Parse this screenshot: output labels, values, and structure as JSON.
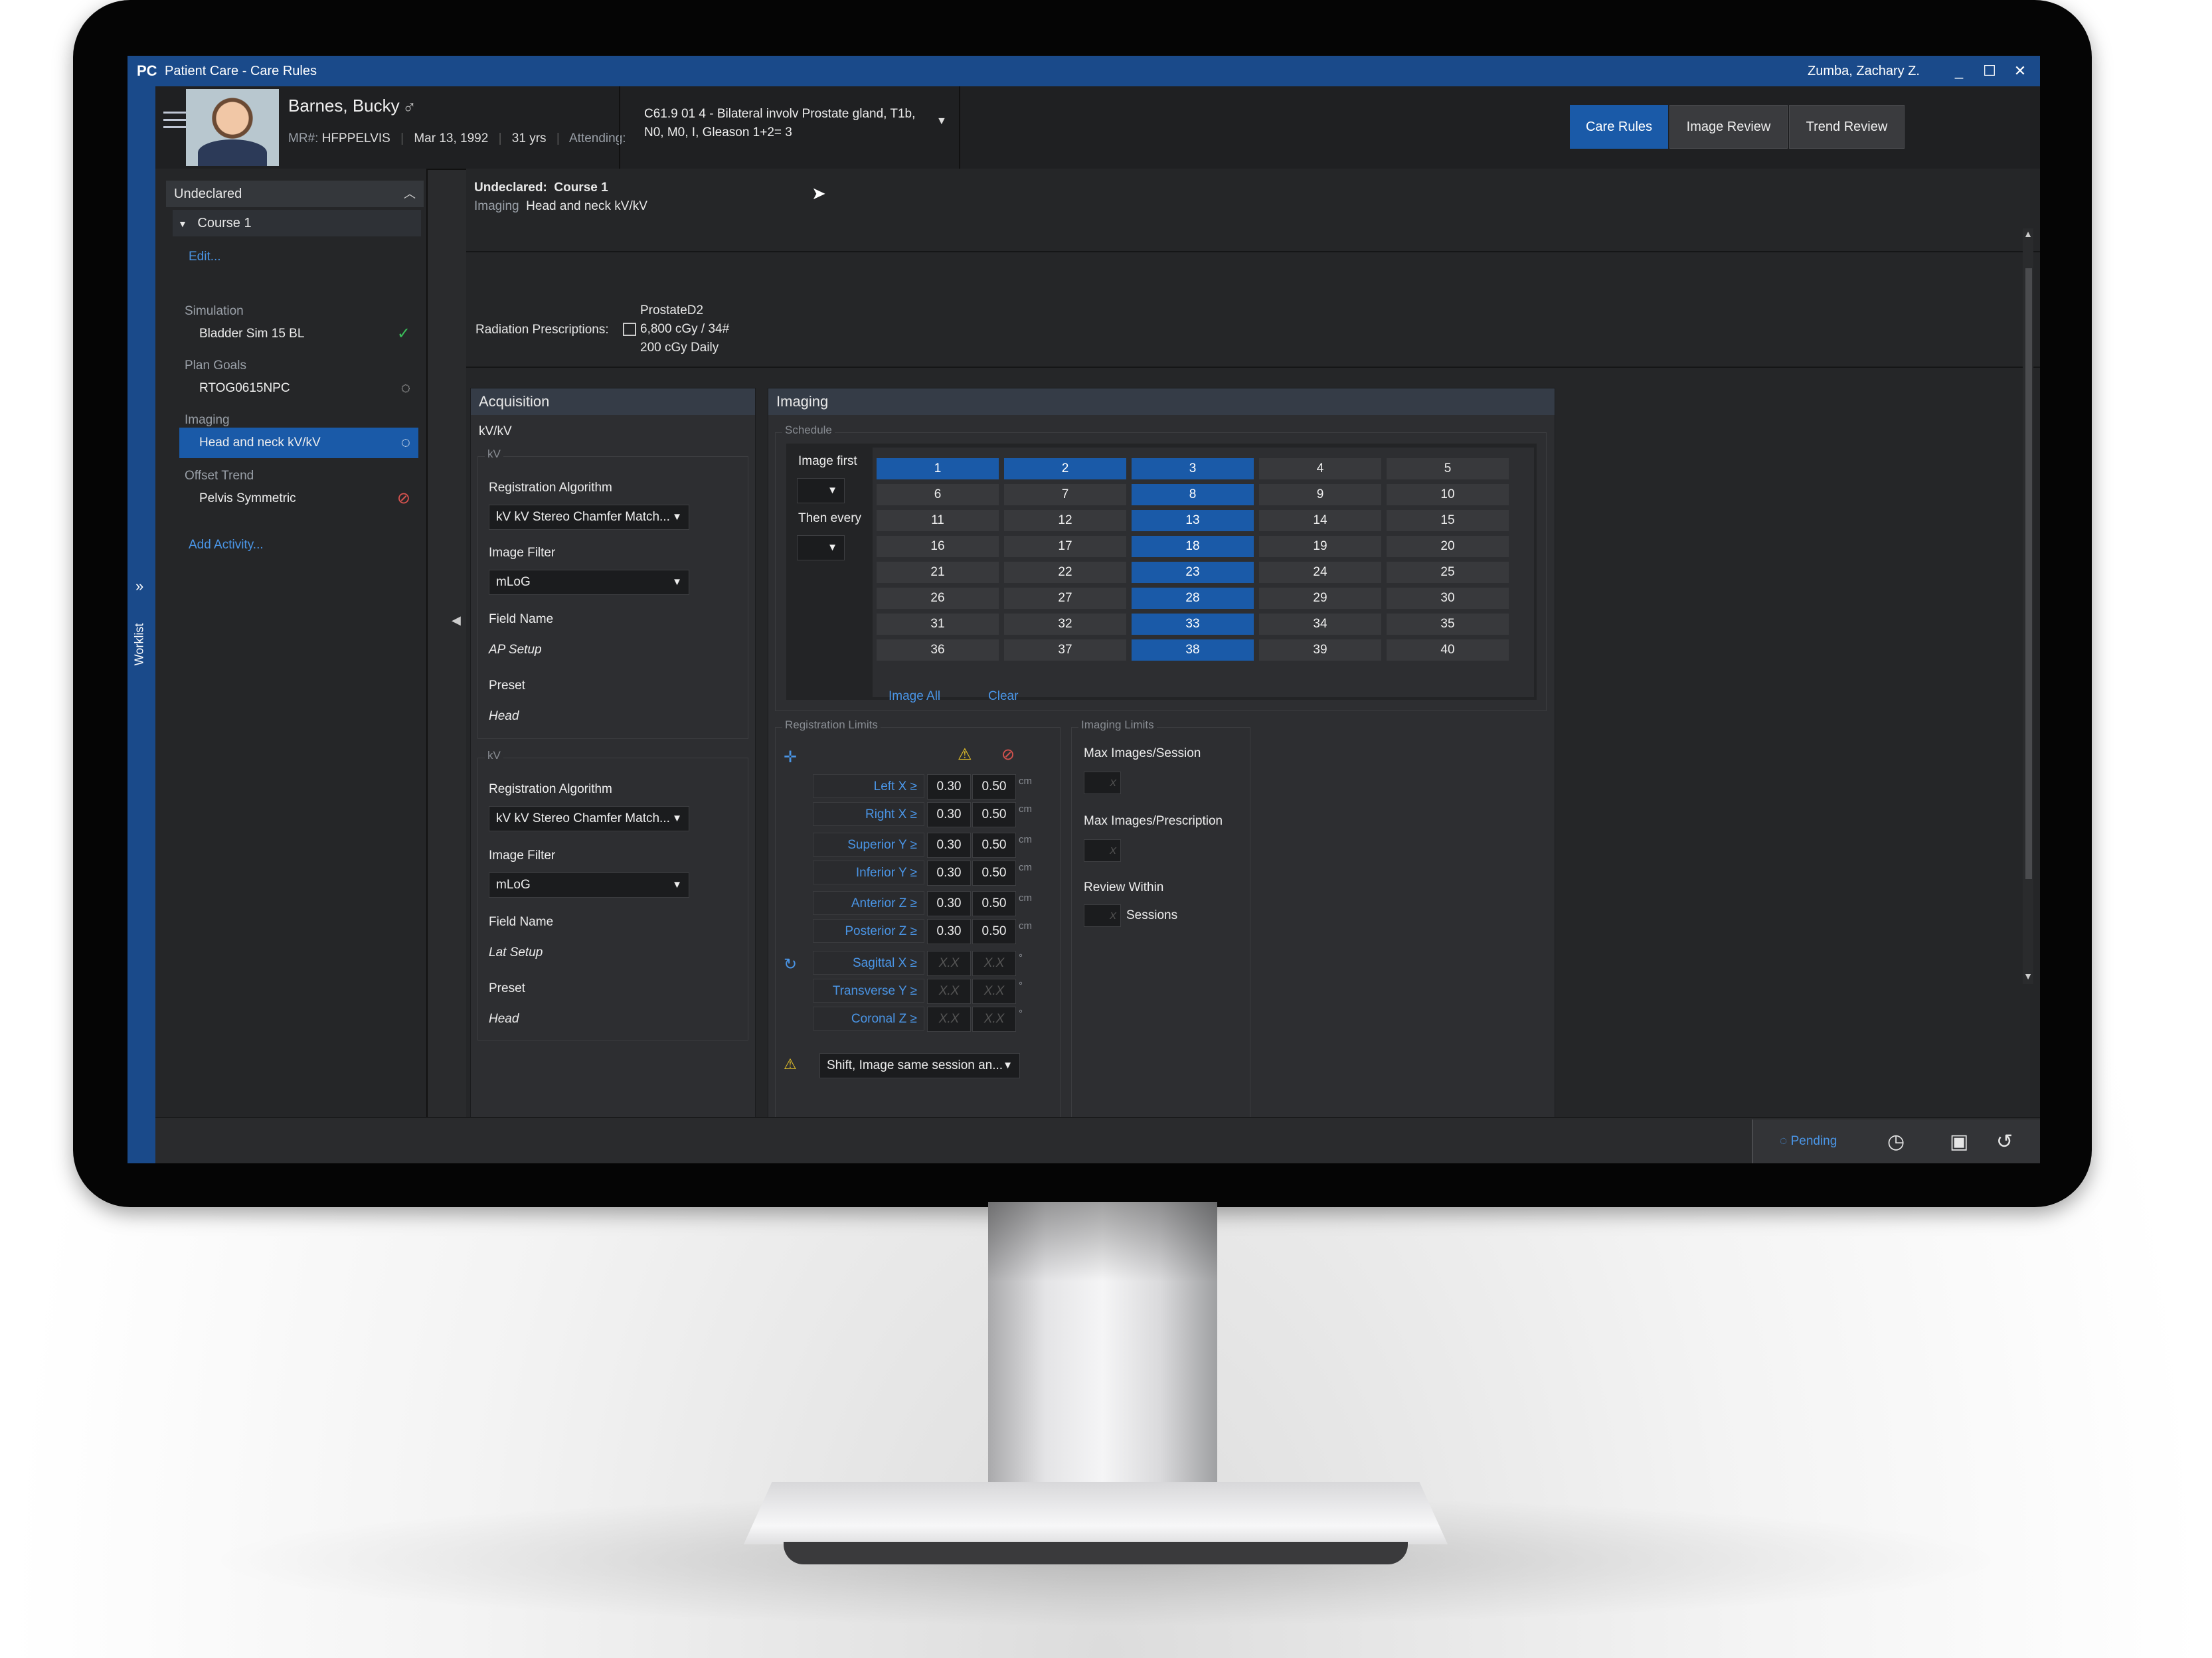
{
  "window": {
    "logo": "PC",
    "title": "Patient Care - Care Rules",
    "user": "Zumba, Zachary Z.",
    "controls": [
      "_",
      "☐",
      "✕"
    ]
  },
  "worklist": {
    "label": "Worklist",
    "icon": "double-chevron-right-icon"
  },
  "patient": {
    "name": "Barnes, Bucky",
    "gender_symbol": "♂",
    "mrn_label": "MR#:",
    "mrn": "HFPPELVIS",
    "dob": "Mar 13, 1992",
    "age": "31 yrs",
    "attending_label": "Attending:",
    "attending": "",
    "diagnosis_line1": "C61.9 01 4 - Bilateral involv Prostate gland, T1b,",
    "diagnosis_line2": "N0, M0, I, Gleason 1+2= 3"
  },
  "top_tabs": [
    {
      "label": "Care Rules",
      "active": true
    },
    {
      "label": "Image Review",
      "active": false
    },
    {
      "label": "Trend Review",
      "active": false
    }
  ],
  "nav": {
    "section": "Undeclared",
    "course": "Course 1",
    "edit_link": "Edit...",
    "groups": [
      {
        "label": "Simulation",
        "item": "Bladder Sim 15 BL",
        "status": "check",
        "status_color": "#3bbf5a"
      },
      {
        "label": "Plan Goals",
        "item": "RTOG0615NPC",
        "status": "pending",
        "status_color": "#dddddd"
      },
      {
        "label": "Imaging",
        "item": "Head and neck kV/kV",
        "status": "pending",
        "status_color": "#ffffff",
        "selected": true
      },
      {
        "label": "Offset Trend",
        "item": "Pelvis Symmetric",
        "status": "blocked",
        "status_color": "#d9534f"
      }
    ],
    "add_link": "Add Activity..."
  },
  "breadcrumb": {
    "prefix": "Undeclared:",
    "course": "Course 1",
    "type_label": "Imaging",
    "activity": "Head and neck kV/kV"
  },
  "prescription": {
    "label": "Radiation Prescriptions:",
    "name": "ProstateD2",
    "dose": "6,800 cGy / 34#",
    "fraction": "200 cGy Daily"
  },
  "acquisition": {
    "title": "Acquisition",
    "mode": "kV/kV",
    "blocks": [
      {
        "caption": "kV",
        "reg_algo_label": "Registration Algorithm",
        "reg_algo_value": "kV kV Stereo Chamfer Match...",
        "filter_label": "Image Filter",
        "filter_value": "mLoG",
        "field_label": "Field Name",
        "field_value": "AP Setup",
        "preset_label": "Preset",
        "preset_value": "Head"
      },
      {
        "caption": "kV",
        "reg_algo_label": "Registration Algorithm",
        "reg_algo_value": "kV kV Stereo Chamfer Match...",
        "filter_label": "Image Filter",
        "filter_value": "mLoG",
        "field_label": "Field Name",
        "field_value": "Lat Setup",
        "preset_label": "Preset",
        "preset_value": "Head"
      }
    ]
  },
  "imaging": {
    "title": "Imaging",
    "schedule_caption": "Schedule",
    "image_first_label": "Image first",
    "then_every_label": "Then every",
    "selected_fractions": [
      1,
      2,
      3,
      8,
      13,
      18,
      23,
      28,
      33,
      38
    ],
    "fractions": [
      "1",
      "2",
      "3",
      "4",
      "5",
      "6",
      "7",
      "8",
      "9",
      "10",
      "11",
      "12",
      "13",
      "14",
      "15",
      "16",
      "17",
      "18",
      "19",
      "20",
      "21",
      "22",
      "23",
      "24",
      "25",
      "26",
      "27",
      "28",
      "29",
      "30",
      "31",
      "32",
      "33",
      "34",
      "35",
      "36",
      "37",
      "38",
      "39",
      "40"
    ],
    "image_all_link": "Image All",
    "clear_link": "Clear",
    "registration_limits": {
      "caption": "Registration Limits",
      "translation_rows": [
        {
          "label": "Left X ≥",
          "warn": "0.30",
          "stop": "0.50",
          "unit": "cm"
        },
        {
          "label": "Right X ≥",
          "warn": "0.30",
          "stop": "0.50",
          "unit": "cm"
        },
        {
          "label": "Superior Y ≥",
          "warn": "0.30",
          "stop": "0.50",
          "unit": "cm"
        },
        {
          "label": "Inferior Y ≥",
          "warn": "0.30",
          "stop": "0.50",
          "unit": "cm"
        },
        {
          "label": "Anterior Z ≥",
          "warn": "0.30",
          "stop": "0.50",
          "unit": "cm"
        },
        {
          "label": "Posterior Z ≥",
          "warn": "0.30",
          "stop": "0.50",
          "unit": "cm"
        }
      ],
      "rotation_rows": [
        {
          "label": "Sagittal X ≥",
          "warn": "X.X",
          "stop": "X.X",
          "unit": "°"
        },
        {
          "label": "Transverse Y ≥",
          "warn": "X.X",
          "stop": "X.X",
          "unit": "°"
        },
        {
          "label": "Coronal Z ≥",
          "warn": "X.X",
          "stop": "X.X",
          "unit": "°"
        }
      ],
      "action_value": "Shift, Image same session an..."
    },
    "imaging_limits": {
      "caption": "Imaging Limits",
      "max_session_label": "Max Images/Session",
      "max_prescription_label": "Max Images/Prescription",
      "review_within_label": "Review Within",
      "sessions_label": "Sessions",
      "placeholder": "X"
    }
  },
  "footer": {
    "status": "Pending"
  }
}
